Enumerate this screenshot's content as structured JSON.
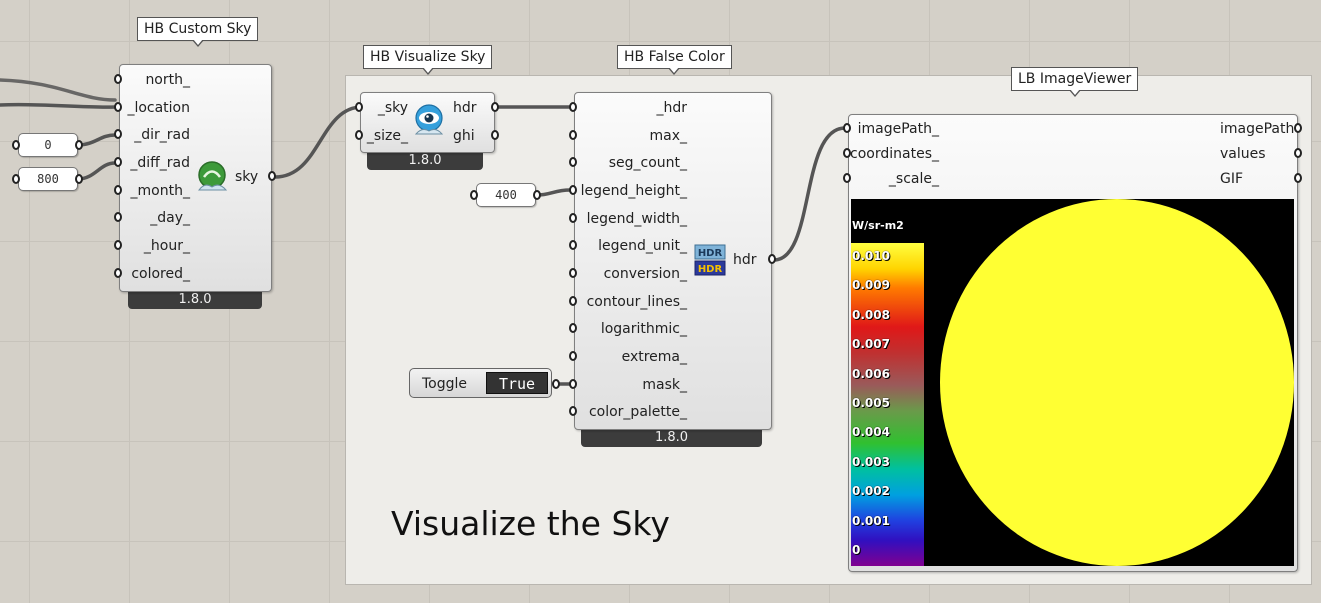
{
  "colors": {
    "canvas": "#d4d0c8",
    "group": "#eeede9",
    "component_footer": "#3c3c3c",
    "sky_disc": "#ffff33",
    "viewer_background": "#000000"
  },
  "group": {
    "title": "Visualize the Sky"
  },
  "components": {
    "custom_sky": {
      "tag": "HB Custom Sky",
      "inputs": [
        "north_",
        "_location",
        "_dir_rad",
        "_diff_rad",
        "_month_",
        "_day_",
        "_hour_",
        "colored_"
      ],
      "outputs": [
        "sky"
      ],
      "icon": "custom-sky-icon",
      "version": "1.8.0"
    },
    "visualize_sky": {
      "tag": "HB Visualize Sky",
      "inputs": [
        "_sky",
        "_size_"
      ],
      "outputs": [
        "hdr",
        "ghi"
      ],
      "icon": "eye-icon",
      "version": "1.8.0"
    },
    "false_color": {
      "tag": "HB False Color",
      "inputs": [
        "_hdr",
        "max_",
        "seg_count_",
        "legend_height_",
        "legend_width_",
        "legend_unit_",
        "conversion_",
        "contour_lines_",
        "logarithmic_",
        "extrema_",
        "mask_",
        "color_palette_"
      ],
      "outputs": [
        "hdr"
      ],
      "icon": "hdr-icon",
      "icon_text": [
        "HDR",
        "HDR"
      ],
      "version": "1.8.0"
    },
    "image_viewer": {
      "tag": "LB ImageViewer",
      "inputs": [
        "imagePath_",
        "coordinates_",
        "_scale_"
      ],
      "outputs": [
        "imagePath",
        "values",
        "GIF"
      ],
      "legend": {
        "unit": "W/sr-m2",
        "ticks": [
          "0.010",
          "0.009",
          "0.008",
          "0.007",
          "0.006",
          "0.005",
          "0.004",
          "0.003",
          "0.002",
          "0.001",
          "0"
        ]
      }
    }
  },
  "params": {
    "dir_rad": "0",
    "diff_rad": "800",
    "legend_height": "400"
  },
  "toggle": {
    "label": "Toggle",
    "value": "True"
  }
}
